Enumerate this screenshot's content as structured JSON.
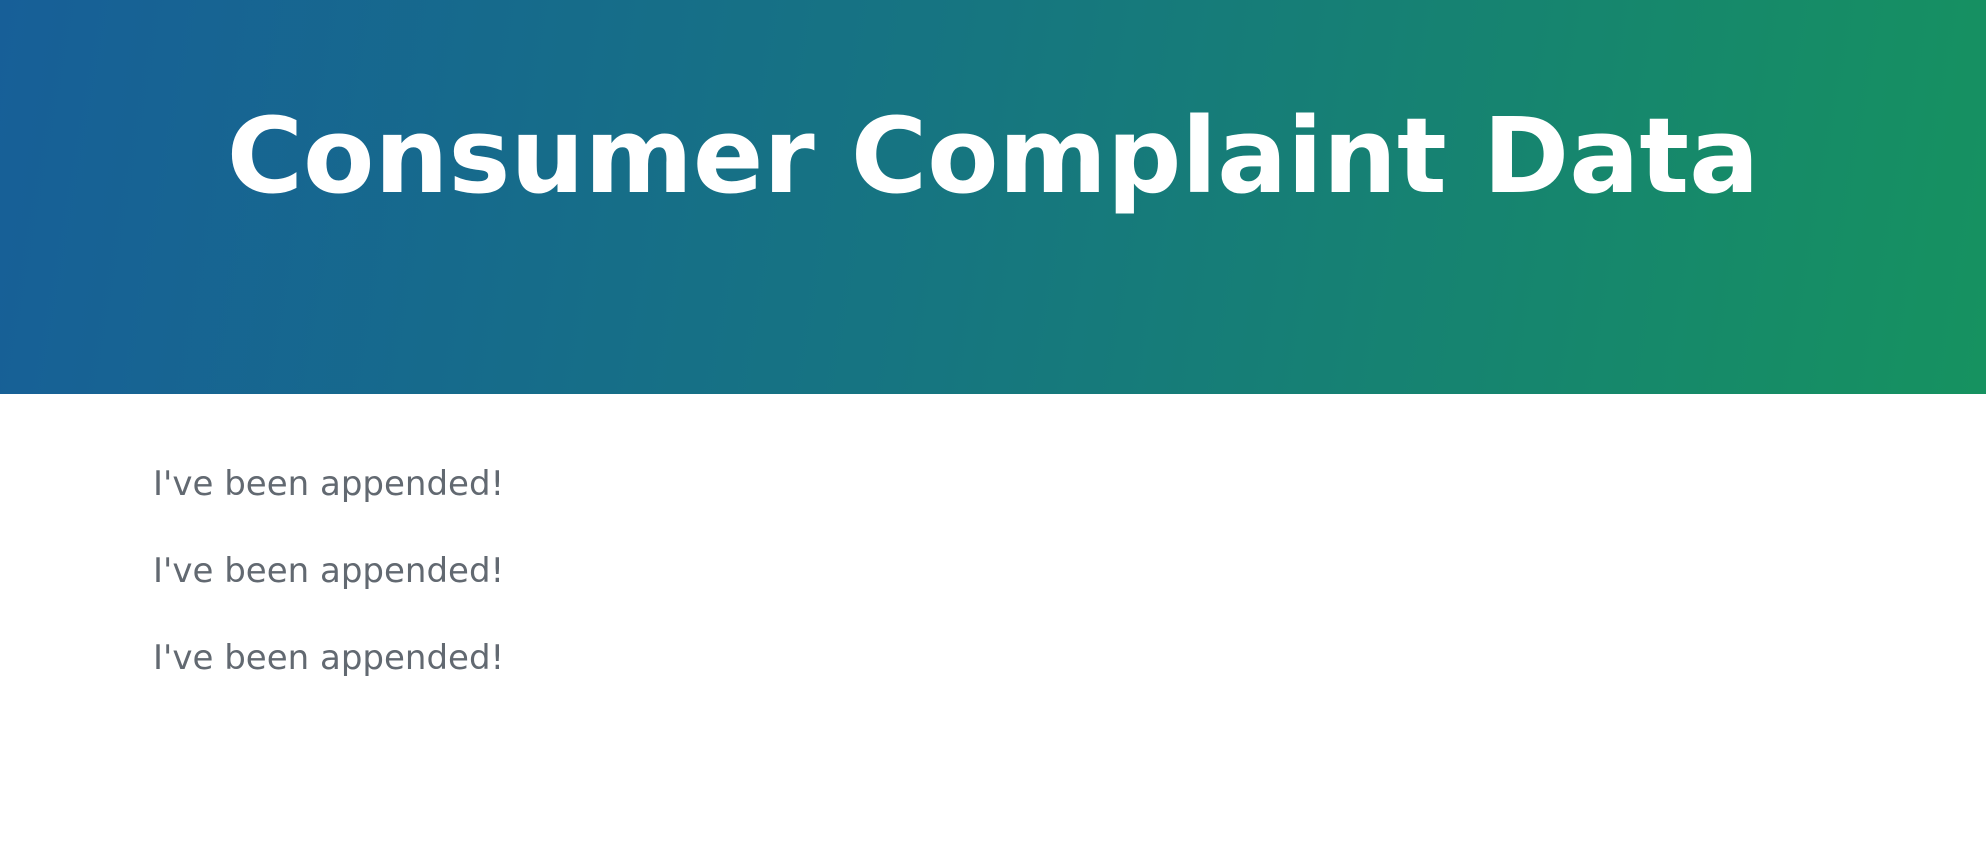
{
  "header": {
    "title": "Consumer Complaint Data"
  },
  "main": {
    "messages": [
      "I've been appended!",
      "I've been appended!",
      "I've been appended!"
    ]
  },
  "colors": {
    "gradient_start": "#175f98",
    "gradient_end": "#169260",
    "title_text": "#ffffff",
    "body_text": "#626971"
  }
}
